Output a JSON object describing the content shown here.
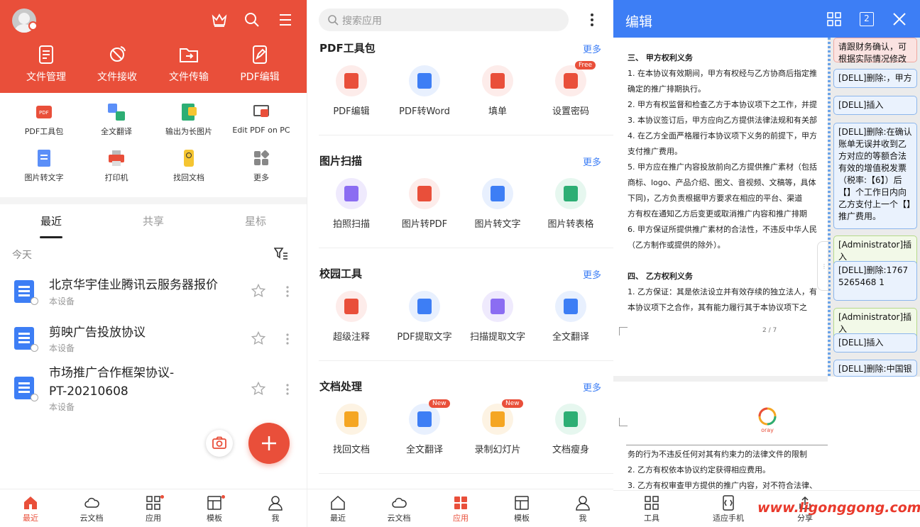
{
  "panel1": {
    "tools": [
      {
        "label": "文件管理",
        "icon": "file-manage-icon"
      },
      {
        "label": "文件接收",
        "icon": "file-receive-icon"
      },
      {
        "label": "文件传输",
        "icon": "file-transfer-icon"
      },
      {
        "label": "PDF编辑",
        "icon": "pdf-edit-icon"
      }
    ],
    "grid": [
      {
        "label": "PDF工具包"
      },
      {
        "label": "全文翻译"
      },
      {
        "label": "输出为长图片"
      },
      {
        "label": "Edit PDF on PC"
      },
      {
        "label": "图片转文字"
      },
      {
        "label": "打印机"
      },
      {
        "label": "找回文档"
      },
      {
        "label": "更多"
      }
    ],
    "tabs": [
      "最近",
      "共享",
      "星标"
    ],
    "today": "今天",
    "docs": [
      {
        "title": "北京华宇佳业腾讯云服务器报价",
        "sub": "本设备"
      },
      {
        "title": "剪映广告投放协议",
        "sub": "本设备"
      },
      {
        "title": "市场推广合作框架协议-PT-20210608",
        "sub": "本设备"
      }
    ],
    "bottom_nav": [
      "最近",
      "云文档",
      "应用",
      "模板",
      "我"
    ],
    "accent": "#e94f3a"
  },
  "panel2": {
    "search_placeholder": "搜索应用",
    "more_label": "更多",
    "sections": [
      {
        "title": "PDF工具包",
        "apps": [
          {
            "label": "PDF编辑"
          },
          {
            "label": "PDF转Word"
          },
          {
            "label": "填单"
          },
          {
            "label": "设置密码",
            "tag": "Free"
          }
        ]
      },
      {
        "title": "图片扫描",
        "apps": [
          {
            "label": "拍照扫描"
          },
          {
            "label": "图片转PDF"
          },
          {
            "label": "图片转文字"
          },
          {
            "label": "图片转表格"
          }
        ]
      },
      {
        "title": "校园工具",
        "apps": [
          {
            "label": "超级注释"
          },
          {
            "label": "PDF提取文字"
          },
          {
            "label": "扫描提取文字"
          },
          {
            "label": "全文翻译"
          }
        ]
      },
      {
        "title": "文档处理",
        "apps": [
          {
            "label": "找回文档"
          },
          {
            "label": "全文翻译",
            "tag": "New"
          },
          {
            "label": "录制幻灯片",
            "tag": "New"
          },
          {
            "label": "文档瘦身"
          }
        ]
      }
    ],
    "bottom_nav": [
      "最近",
      "云文档",
      "应用",
      "模板",
      "我"
    ]
  },
  "panel3": {
    "title": "编辑",
    "page_count_badge": "2",
    "doc_lines": [
      "三、    甲方权利义务",
      "1.  在本协议有效期间，甲方有权经与乙方协商后指定推",
      "     确定的推广排期执行。",
      "2.  甲方有权监督和检查乙方于本协议项下之工作，并提",
      "3.  本协议签订后，甲方应向乙方提供法律法规和有关部",
      "4.  在乙方全面严格履行本协议项下义务的前提下，甲方",
      "     支付推广费用。",
      "5.  甲方应在推广内容投放前向乙方提供推广素材（包括",
      "     商标、logo、产品介绍、图文、音视频、文稿等，具体",
      "     下同)，乙方负责根据甲方要求在相应的平台、渠道",
      "     方有权在通知乙方后变更或取消推广内容和推广排期",
      "6.  甲方保证所提供推广素材的合法性，不违反中华人民",
      "     （乙方制作或提供的除外）。",
      "四、    乙方权利义务",
      "1.  乙方保证：其是依法设立并有效存续的独立法人，有",
      "     本协议项下之合作，其有能力履行其于本协议项下之"
    ],
    "page_num": "2 / 7",
    "logo_text": "oray",
    "doc_lines2": [
      "     务的行为不违反任何对其有约束力的法律文件的限制",
      "2.  乙方有权依本协议约定获得相应费用。",
      "3.  乙方有权审查甲方提供的推广内容，对不符合法律、"
    ],
    "comments": [
      {
        "text": "请跟财务确认，可根据实际情况修改",
        "type": "top"
      },
      {
        "text": "[DELL]删除:，甲方",
        "type": "dell"
      },
      {
        "text": "[DELL]插入",
        "type": "dell"
      },
      {
        "text": "[DELL]删除:在确认账单无误并收到乙方对应的等额合法有效的增值税发票（税率:【6】）后【】个工作日内向乙方支付上一个【】推广费用。",
        "type": "dell"
      },
      {
        "text": "[Administrator]插入",
        "type": "admin"
      },
      {
        "text": "[DELL]删除:17675265468 1",
        "type": "dell"
      },
      {
        "text": "[Administrator]插入",
        "type": "admin"
      },
      {
        "text": "[DELL]插入",
        "type": "dell"
      },
      {
        "text": "[DELL]删除:中国银",
        "type": "dell"
      }
    ],
    "bottom_nav": [
      "工具",
      "适应手机",
      "分享"
    ],
    "accent": "#3d7ef5"
  },
  "watermark": "www.ligonggong.com"
}
